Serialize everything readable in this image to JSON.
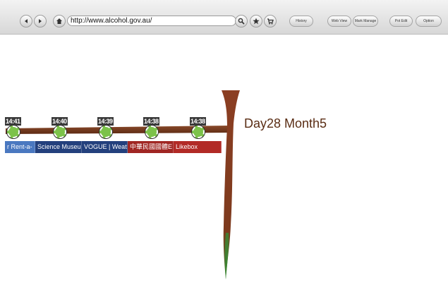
{
  "toolbar": {
    "url": "http://www.alcohol.gov.au/",
    "buttons": {
      "history": "History",
      "web_view": "Web View",
      "mark_manage": "Mark Manage",
      "pot_edit": "Pot Edit",
      "option": "Option"
    }
  },
  "timeline": {
    "date_label": "Day28 Month5",
    "nodes": [
      {
        "time": "14:41"
      },
      {
        "time": "14:40"
      },
      {
        "time": "14:39"
      },
      {
        "time": "14:38"
      },
      {
        "time": "14:38"
      }
    ],
    "tabs": [
      {
        "label": "r Rent-a-",
        "color": "#4a78c0"
      },
      {
        "label": "Science Museu",
        "color": "#23407d"
      },
      {
        "label": "VOGUE | Weath",
        "color": "#23407d"
      },
      {
        "label": "中華民國國體E",
        "color": "#a02623"
      },
      {
        "label": "Likebox",
        "color": "#b22a26"
      }
    ]
  },
  "colors": {
    "branch": "#6e3419",
    "trunk": "#8b3e22",
    "trunk_tip": "#3a8a35",
    "node": "#7cc24a"
  }
}
